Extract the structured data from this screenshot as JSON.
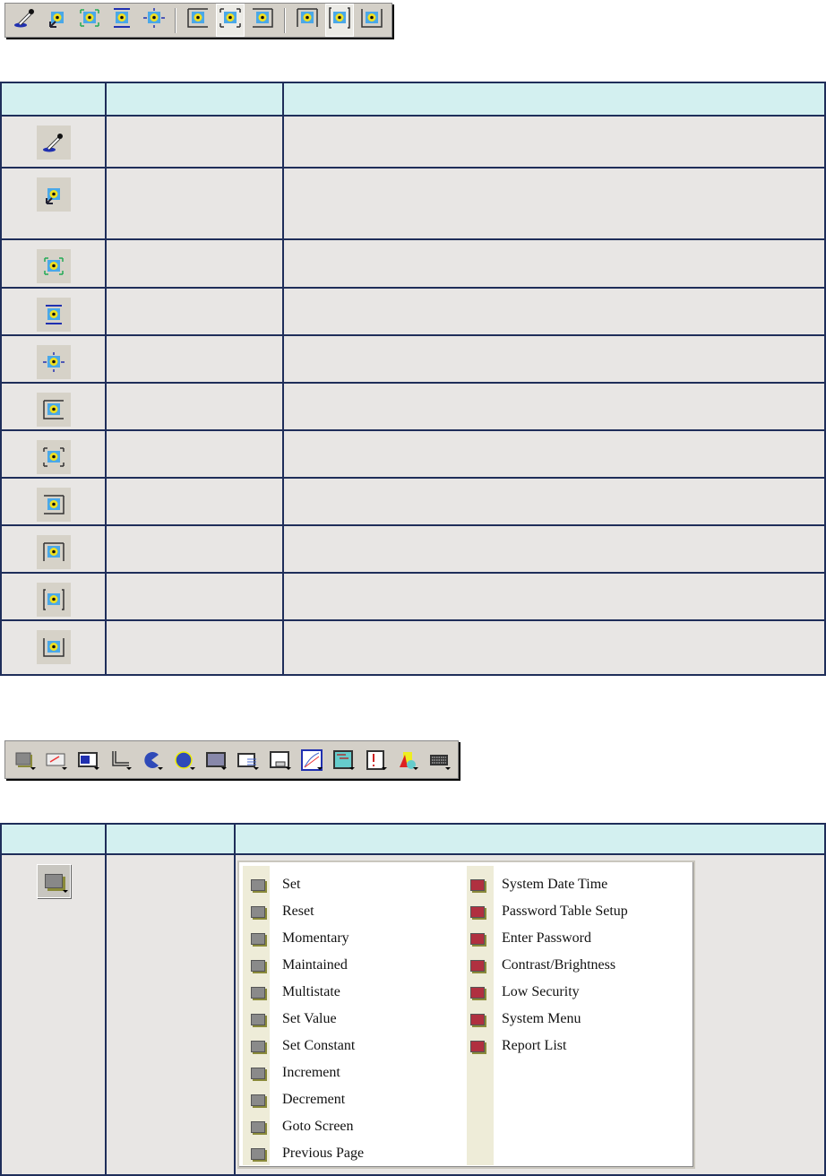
{
  "toolbar1": {
    "buttons": [
      "eyedropper-icon",
      "replace-image-icon",
      "fit-center-icon",
      "tile-icon",
      "center-icon",
      "align-left-icon",
      "align-center-h-icon",
      "align-right-icon",
      "align-top-icon",
      "align-middle-v-icon",
      "align-bottom-icon"
    ],
    "pressed": [
      6,
      9
    ]
  },
  "table1": {
    "rows": 11
  },
  "toolbar2": {
    "buttons": [
      "push-button-icon",
      "gauge-icon",
      "indicator-icon",
      "line-icon",
      "pie-icon",
      "circle-icon",
      "bar-graph-icon",
      "message-display-icon",
      "data-entry-icon",
      "trend-icon",
      "alarm-banner-icon",
      "alarm-icon",
      "object-icon",
      "keypad-icon"
    ]
  },
  "menu": {
    "left": [
      "Set",
      "Reset",
      "Momentary",
      "Maintained",
      "Multistate",
      "Set Value",
      "Set Constant",
      "Increment",
      "Decrement",
      "Goto Screen",
      "Previous Page"
    ],
    "right": [
      "System Date Time",
      "Password Table Setup",
      "Enter Password",
      "Contrast/Brightness",
      "Low Security",
      "System Menu",
      "Report List"
    ]
  }
}
